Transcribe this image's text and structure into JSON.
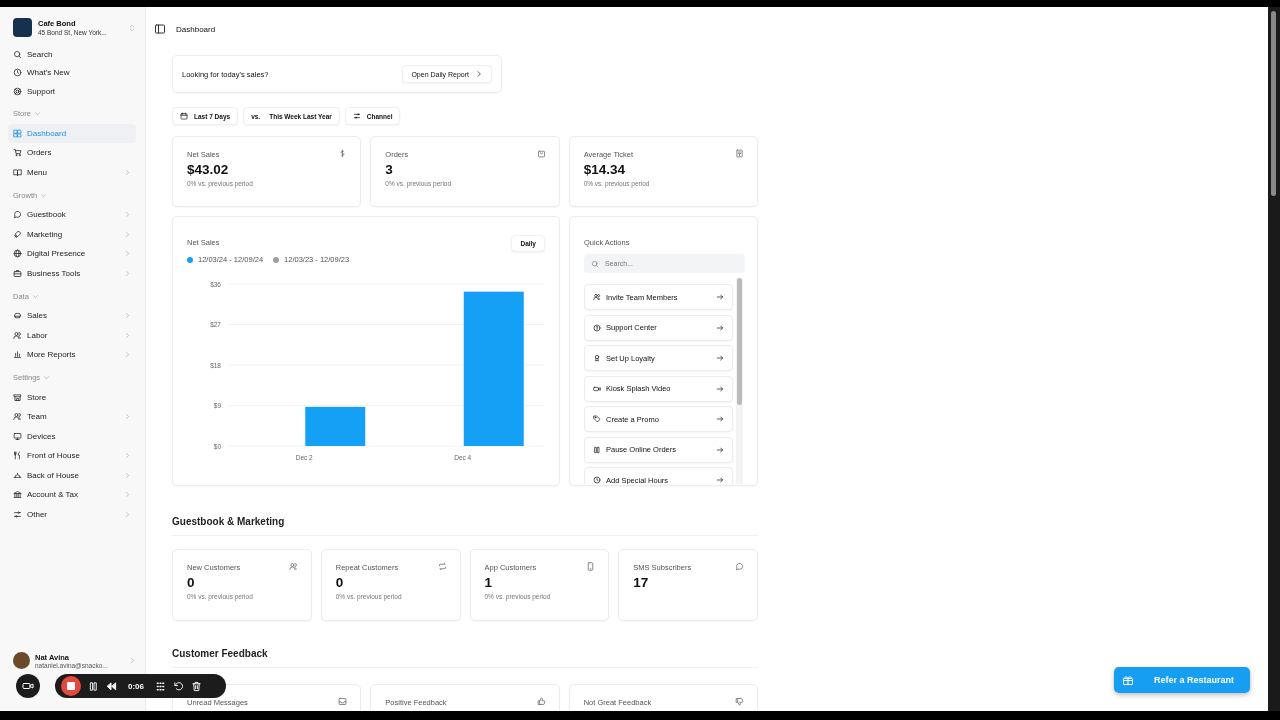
{
  "store": {
    "name": "Cafe Bond",
    "address": "45 Bond St, New York..."
  },
  "nav_top": [
    {
      "label": "Search"
    },
    {
      "label": "What's New"
    },
    {
      "label": "Support"
    }
  ],
  "nav_sections": [
    {
      "label": "Store",
      "expanded": true,
      "items": [
        {
          "label": "Dashboard",
          "selected": true,
          "has_submenu": false
        },
        {
          "label": "Orders",
          "selected": false,
          "has_submenu": false
        },
        {
          "label": "Menu",
          "selected": false,
          "has_submenu": true
        }
      ]
    },
    {
      "label": "Growth",
      "expanded": true,
      "items": [
        {
          "label": "Guestbook",
          "selected": false,
          "has_submenu": true
        },
        {
          "label": "Marketing",
          "selected": false,
          "has_submenu": true
        },
        {
          "label": "Digital Presence",
          "selected": false,
          "has_submenu": true
        },
        {
          "label": "Business Tools",
          "selected": false,
          "has_submenu": true
        }
      ]
    },
    {
      "label": "Data",
      "expanded": true,
      "items": [
        {
          "label": "Sales",
          "selected": false,
          "has_submenu": true
        },
        {
          "label": "Labor",
          "selected": false,
          "has_submenu": true
        },
        {
          "label": "More Reports",
          "selected": false,
          "has_submenu": true
        }
      ]
    },
    {
      "label": "Settings",
      "expanded": true,
      "items": [
        {
          "label": "Store",
          "selected": false,
          "has_submenu": false
        },
        {
          "label": "Team",
          "selected": false,
          "has_submenu": true
        },
        {
          "label": "Devices",
          "selected": false,
          "has_submenu": false
        },
        {
          "label": "Front of House",
          "selected": false,
          "has_submenu": true
        },
        {
          "label": "Back of House",
          "selected": false,
          "has_submenu": true
        },
        {
          "label": "Account & Tax",
          "selected": false,
          "has_submenu": true
        },
        {
          "label": "Other",
          "selected": false,
          "has_submenu": true
        }
      ]
    }
  ],
  "user": {
    "name": "Nat Avina",
    "email": "nataniel.avina@snacko..."
  },
  "header": {
    "title": "Dashboard"
  },
  "banner": {
    "text": "Looking for today's sales?",
    "button": "Open Daily Report"
  },
  "filters": [
    {
      "label": "Last 7 Days"
    },
    {
      "prefix": "vs.",
      "label": "This Week Last Year"
    },
    {
      "label": "Channel"
    }
  ],
  "kpis": [
    {
      "label": "Net Sales",
      "value": "$43.02",
      "change": "0% vs. previous period"
    },
    {
      "label": "Orders",
      "value": "3",
      "change": "0% vs. previous period"
    },
    {
      "label": "Average Ticket",
      "value": "$14.34",
      "change": "0% vs. previous period"
    }
  ],
  "sales_chart": {
    "title": "Net Sales",
    "interval": "Daily",
    "chart_data": {
      "type": "bar",
      "categories": [
        "Dec 2",
        "Dec 4"
      ],
      "series": [
        {
          "name": "12/03/24 - 12/09/24",
          "color": "#14a0f5",
          "values": [
            8.7,
            34.3
          ]
        },
        {
          "name": "12/03/23 - 12/09/23",
          "color": "#9e9e9e",
          "values": [
            null,
            null
          ]
        }
      ],
      "grid": true,
      "ylim": [
        0,
        36
      ],
      "yticks": [
        {
          "value": 0,
          "label": "$0"
        },
        {
          "value": 9,
          "label": "$9"
        },
        {
          "value": 18,
          "label": "$18"
        },
        {
          "value": 27,
          "label": "$27"
        },
        {
          "value": 36,
          "label": "$36"
        }
      ]
    }
  },
  "quick_actions": {
    "title": "Quick Actions",
    "search": {
      "placeholder": "Search..."
    },
    "items": [
      {
        "label": "Invite Team Members"
      },
      {
        "label": "Support Center"
      },
      {
        "label": "Set Up Loyalty"
      },
      {
        "label": "Kiosk Splash Video"
      },
      {
        "label": "Create a Promo"
      },
      {
        "label": "Pause Online Orders"
      },
      {
        "label": "Add Special Hours"
      }
    ]
  },
  "sections": [
    {
      "title": "Guestbook & Marketing",
      "cards": [
        {
          "label": "New Customers",
          "value": "0",
          "change": "0% vs. previous period"
        },
        {
          "label": "Repeat Customers",
          "value": "0",
          "change": "0% vs. previous period"
        },
        {
          "label": "App Customers",
          "value": "1",
          "change": "0% vs. previous period"
        },
        {
          "label": "SMS Subscribers",
          "value": "17"
        }
      ]
    },
    {
      "title": "Customer Feedback",
      "cards": [
        {
          "label": "Unread Messages"
        },
        {
          "label": "Positive Feedback"
        },
        {
          "label": "Not Great Feedback"
        }
      ]
    }
  ],
  "refer_button": "Refer a Restaurant",
  "recorder": {
    "time": "0:06"
  }
}
